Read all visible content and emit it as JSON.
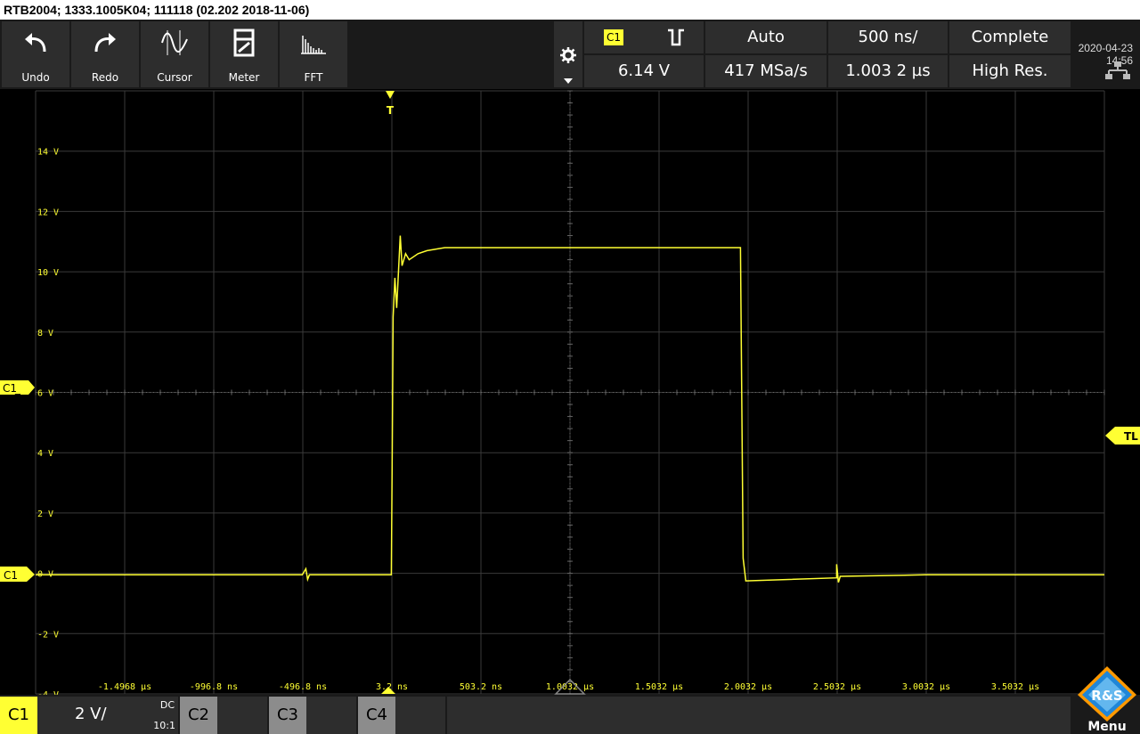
{
  "title_bar": "RTB2004; 1333.1005K04; 111118 (02.202 2018-11-06)",
  "toolbar": {
    "undo": "Undo",
    "redo": "Redo",
    "cursor": "Cursor",
    "meter": "Meter",
    "fft": "FFT"
  },
  "status": {
    "channel_badge": "C1",
    "trigger_mode": "Auto",
    "timebase": "500 ns/",
    "acquisition": "Complete",
    "trigger_level": "6.14 V",
    "sample_rate": "417 MSa/s",
    "trigger_offset": "1.003 2 µs",
    "resolution": "High Res.",
    "date": "2020-04-23",
    "time": "14:56"
  },
  "icons": [
    "undo-icon",
    "redo-icon",
    "cursor-icon",
    "meter-icon",
    "fft-icon",
    "gear-icon",
    "trigger-edge-icon",
    "network-icon",
    "rs-logo"
  ],
  "chart_data": {
    "type": "line",
    "title": "",
    "xlabel": "",
    "ylabel": "",
    "y_ticks": [
      "14 V",
      "12 V",
      "10 V",
      "8 V",
      "6 V",
      "4 V",
      "2 V",
      "0 V",
      "-2 V",
      "-4 V"
    ],
    "x_ticks": [
      "-1.4968 µs",
      "-996.8 ns",
      "-496.8 ns",
      "3.2 ns",
      "503.2 ns",
      "1.0032 µs",
      "1.5032 µs",
      "2.0032 µs",
      "2.5032 µs",
      "3.0032 µs",
      "3.5032 µs"
    ],
    "ylim": [
      -4,
      16
    ],
    "xlim_us": [
      -1.9968,
      4.0032
    ],
    "grid": true,
    "series": [
      {
        "name": "C1",
        "color": "#ffff33",
        "x_us": [
          -1.9968,
          -0.5,
          -0.48,
          -0.47,
          -0.46,
          0.0,
          0.005,
          0.01,
          0.02,
          0.03,
          0.04,
          0.05,
          0.06,
          0.08,
          0.1,
          0.15,
          0.2,
          0.3,
          0.5,
          1.0,
          1.5,
          1.96,
          1.975,
          1.99,
          2.5,
          2.5,
          2.51,
          2.52,
          3.0,
          4.0032
        ],
        "values": [
          -0.05,
          -0.05,
          0.15,
          -0.2,
          -0.05,
          -0.05,
          4.0,
          8.5,
          9.8,
          8.8,
          10.0,
          11.2,
          10.2,
          10.6,
          10.4,
          10.6,
          10.7,
          10.8,
          10.8,
          10.8,
          10.8,
          10.8,
          0.5,
          -0.25,
          -0.15,
          0.3,
          -0.3,
          -0.1,
          -0.05,
          -0.05
        ]
      }
    ],
    "markers": {
      "trigger": "T",
      "trigger_level": "TL",
      "channel_ref": "C1",
      "channel_trigger_label": "C1 ̲"
    }
  },
  "bottom": {
    "c1": "C1",
    "scale": "2 V/",
    "coupling": "DC",
    "probe": "10:1",
    "c2": "C2",
    "c3": "C3",
    "c4": "C4",
    "menu": "Menu"
  }
}
